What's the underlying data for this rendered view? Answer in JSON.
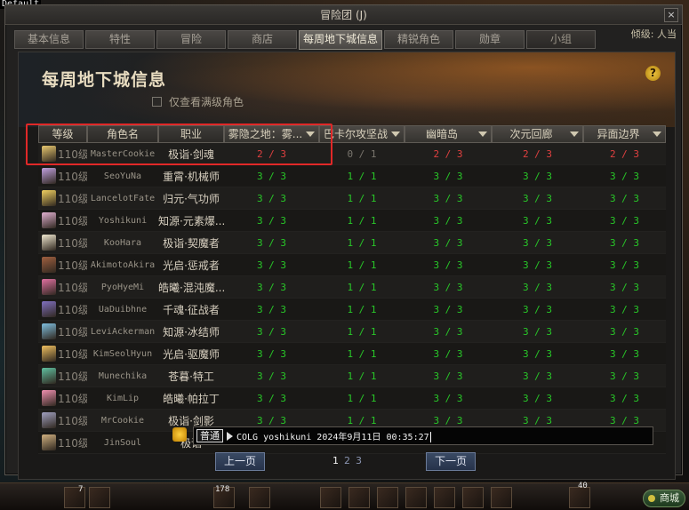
{
  "corner_label": "Default",
  "window": {
    "title": "冒险团 (J)",
    "close_glyph": "×"
  },
  "tabs": [
    {
      "label": "基本信息"
    },
    {
      "label": "特性"
    },
    {
      "label": "冒险"
    },
    {
      "label": "商店"
    },
    {
      "label": "每周地下城信息"
    },
    {
      "label": "精锐角色"
    },
    {
      "label": "勋章"
    },
    {
      "label": "小组"
    }
  ],
  "right_hud": {
    "text": "倾级: 人当"
  },
  "panel": {
    "title": "每周地下城信息",
    "help_glyph": "?",
    "checkbox_label": "仅查看满级角色"
  },
  "table": {
    "headers": {
      "level": "等级",
      "name": "角色名",
      "job": "职业",
      "d1": "雾隐之地：雾...",
      "d2": "巴卡尔攻坚战",
      "d3": "幽暗岛",
      "d4": "次元回廊",
      "d5": "异面边界"
    },
    "rows": [
      {
        "level": "110级",
        "name": "MasterCookie",
        "job": "极诣·剑魂",
        "d1": "2 / 3",
        "d2": "0 / 1",
        "d3": "2 / 3",
        "d4": "2 / 3",
        "d5": "2 / 3"
      },
      {
        "level": "110级",
        "name": "SeoYuNa",
        "job": "重霄·机械师",
        "d1": "3 / 3",
        "d2": "1 / 1",
        "d3": "3 / 3",
        "d4": "3 / 3",
        "d5": "3 / 3"
      },
      {
        "level": "110级",
        "name": "LancelotFate",
        "job": "归元·气功师",
        "d1": "3 / 3",
        "d2": "1 / 1",
        "d3": "3 / 3",
        "d4": "3 / 3",
        "d5": "3 / 3"
      },
      {
        "level": "110级",
        "name": "Yoshikuni",
        "job": "知源·元素爆...",
        "d1": "3 / 3",
        "d2": "1 / 1",
        "d3": "3 / 3",
        "d4": "3 / 3",
        "d5": "3 / 3"
      },
      {
        "level": "110级",
        "name": "KooHara",
        "job": "极诣·契魔者",
        "d1": "3 / 3",
        "d2": "1 / 1",
        "d3": "3 / 3",
        "d4": "3 / 3",
        "d5": "3 / 3"
      },
      {
        "level": "110级",
        "name": "AkimotoAkira",
        "job": "光启·惩戒者",
        "d1": "3 / 3",
        "d2": "1 / 1",
        "d3": "3 / 3",
        "d4": "3 / 3",
        "d5": "3 / 3"
      },
      {
        "level": "110级",
        "name": "PyoHyeMi",
        "job": "皓曦·混沌魔...",
        "d1": "3 / 3",
        "d2": "1 / 1",
        "d3": "3 / 3",
        "d4": "3 / 3",
        "d5": "3 / 3"
      },
      {
        "level": "110级",
        "name": "UaDuibhne",
        "job": "千魂·征战者",
        "d1": "3 / 3",
        "d2": "1 / 1",
        "d3": "3 / 3",
        "d4": "3 / 3",
        "d5": "3 / 3"
      },
      {
        "level": "110级",
        "name": "LeviAckerman",
        "job": "知源·冰结师",
        "d1": "3 / 3",
        "d2": "1 / 1",
        "d3": "3 / 3",
        "d4": "3 / 3",
        "d5": "3 / 3"
      },
      {
        "level": "110级",
        "name": "KimSeolHyun",
        "job": "光启·驱魔师",
        "d1": "3 / 3",
        "d2": "1 / 1",
        "d3": "3 / 3",
        "d4": "3 / 3",
        "d5": "3 / 3"
      },
      {
        "level": "110级",
        "name": "Munechika",
        "job": "苍暮·特工",
        "d1": "3 / 3",
        "d2": "1 / 1",
        "d3": "3 / 3",
        "d4": "3 / 3",
        "d5": "3 / 3"
      },
      {
        "level": "110级",
        "name": "KimLip",
        "job": "皓曦·帕拉丁",
        "d1": "3 / 3",
        "d2": "1 / 1",
        "d3": "3 / 3",
        "d4": "3 / 3",
        "d5": "3 / 3"
      },
      {
        "level": "110级",
        "name": "MrCookie",
        "job": "极诣·剑影",
        "d1": "3 / 3",
        "d2": "1 / 1",
        "d3": "3 / 3",
        "d4": "3 / 3",
        "d5": "3 / 3"
      },
      {
        "level": "110级",
        "name": "JinSoul",
        "job": "极诣",
        "d1": "",
        "d2": "",
        "d3": "",
        "d4": "",
        "d5": ""
      }
    ]
  },
  "avatar_colors": [
    "#e8c870",
    "#c0a0e0",
    "#f0d060",
    "#e0b0d0",
    "#f0e8d0",
    "#a06040",
    "#e070a0",
    "#8070c0",
    "#80c0e0",
    "#f0c060",
    "#60c0a0",
    "#f090b0",
    "#a0a0c0",
    "#d0b080"
  ],
  "value_colors": {
    "complete": "#28c828",
    "incomplete": "#e04040",
    "none": "#7a766e"
  },
  "chat": {
    "mode": "普通",
    "text": "COLG yoshikuni 2024年9月11日 00:35:27"
  },
  "pager": {
    "prev": "上一页",
    "next": "下一页",
    "pages": [
      "1",
      "2",
      "3"
    ],
    "current": "1"
  },
  "hud": {
    "numbers": [
      "7",
      "178",
      "40"
    ],
    "shop": "商城"
  }
}
